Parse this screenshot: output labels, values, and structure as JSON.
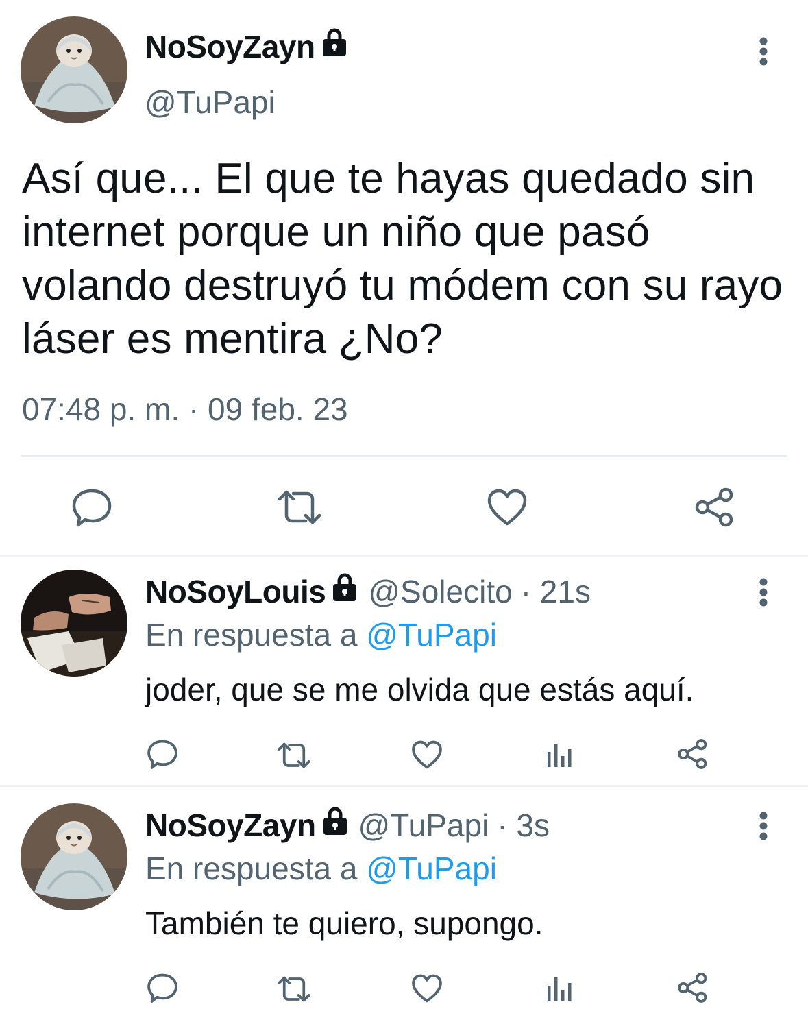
{
  "main_tweet": {
    "display_name": "NoSoyZayn",
    "handle": "@TuPapi",
    "text": "Así que... El que te hayas quedado sin internet porque un niño que pasó volando destruyó tu módem con su rayo láser es mentira ¿No?",
    "timestamp": "07:48 p. m. · 09 feb. 23",
    "actions": [
      "reply-icon",
      "retweet-icon",
      "like-icon",
      "share-icon"
    ]
  },
  "replies": [
    {
      "display_name": "NoSoyLouis",
      "handle": "@Solecito",
      "time": "· 21s",
      "reply_prefix": "En respuesta a",
      "reply_mention": "@TuPapi",
      "text": "joder, que se me olvida que estás aquí.",
      "actions": [
        "reply-icon",
        "retweet-icon",
        "like-icon",
        "analytics-icon",
        "share-icon"
      ]
    },
    {
      "display_name": "NoSoyZayn",
      "handle": "@TuPapi",
      "time": "· 3s",
      "reply_prefix": "En respuesta a",
      "reply_mention": "@TuPapi",
      "text": "También te quiero, supongo.",
      "actions": [
        "reply-icon",
        "retweet-icon",
        "like-icon",
        "analytics-icon",
        "share-icon"
      ]
    }
  ],
  "colors": {
    "text_primary": "#0f1419",
    "text_secondary": "#536471",
    "mention": "#1d9bf0",
    "icon": "#536471",
    "divider": "#e6ebef"
  }
}
